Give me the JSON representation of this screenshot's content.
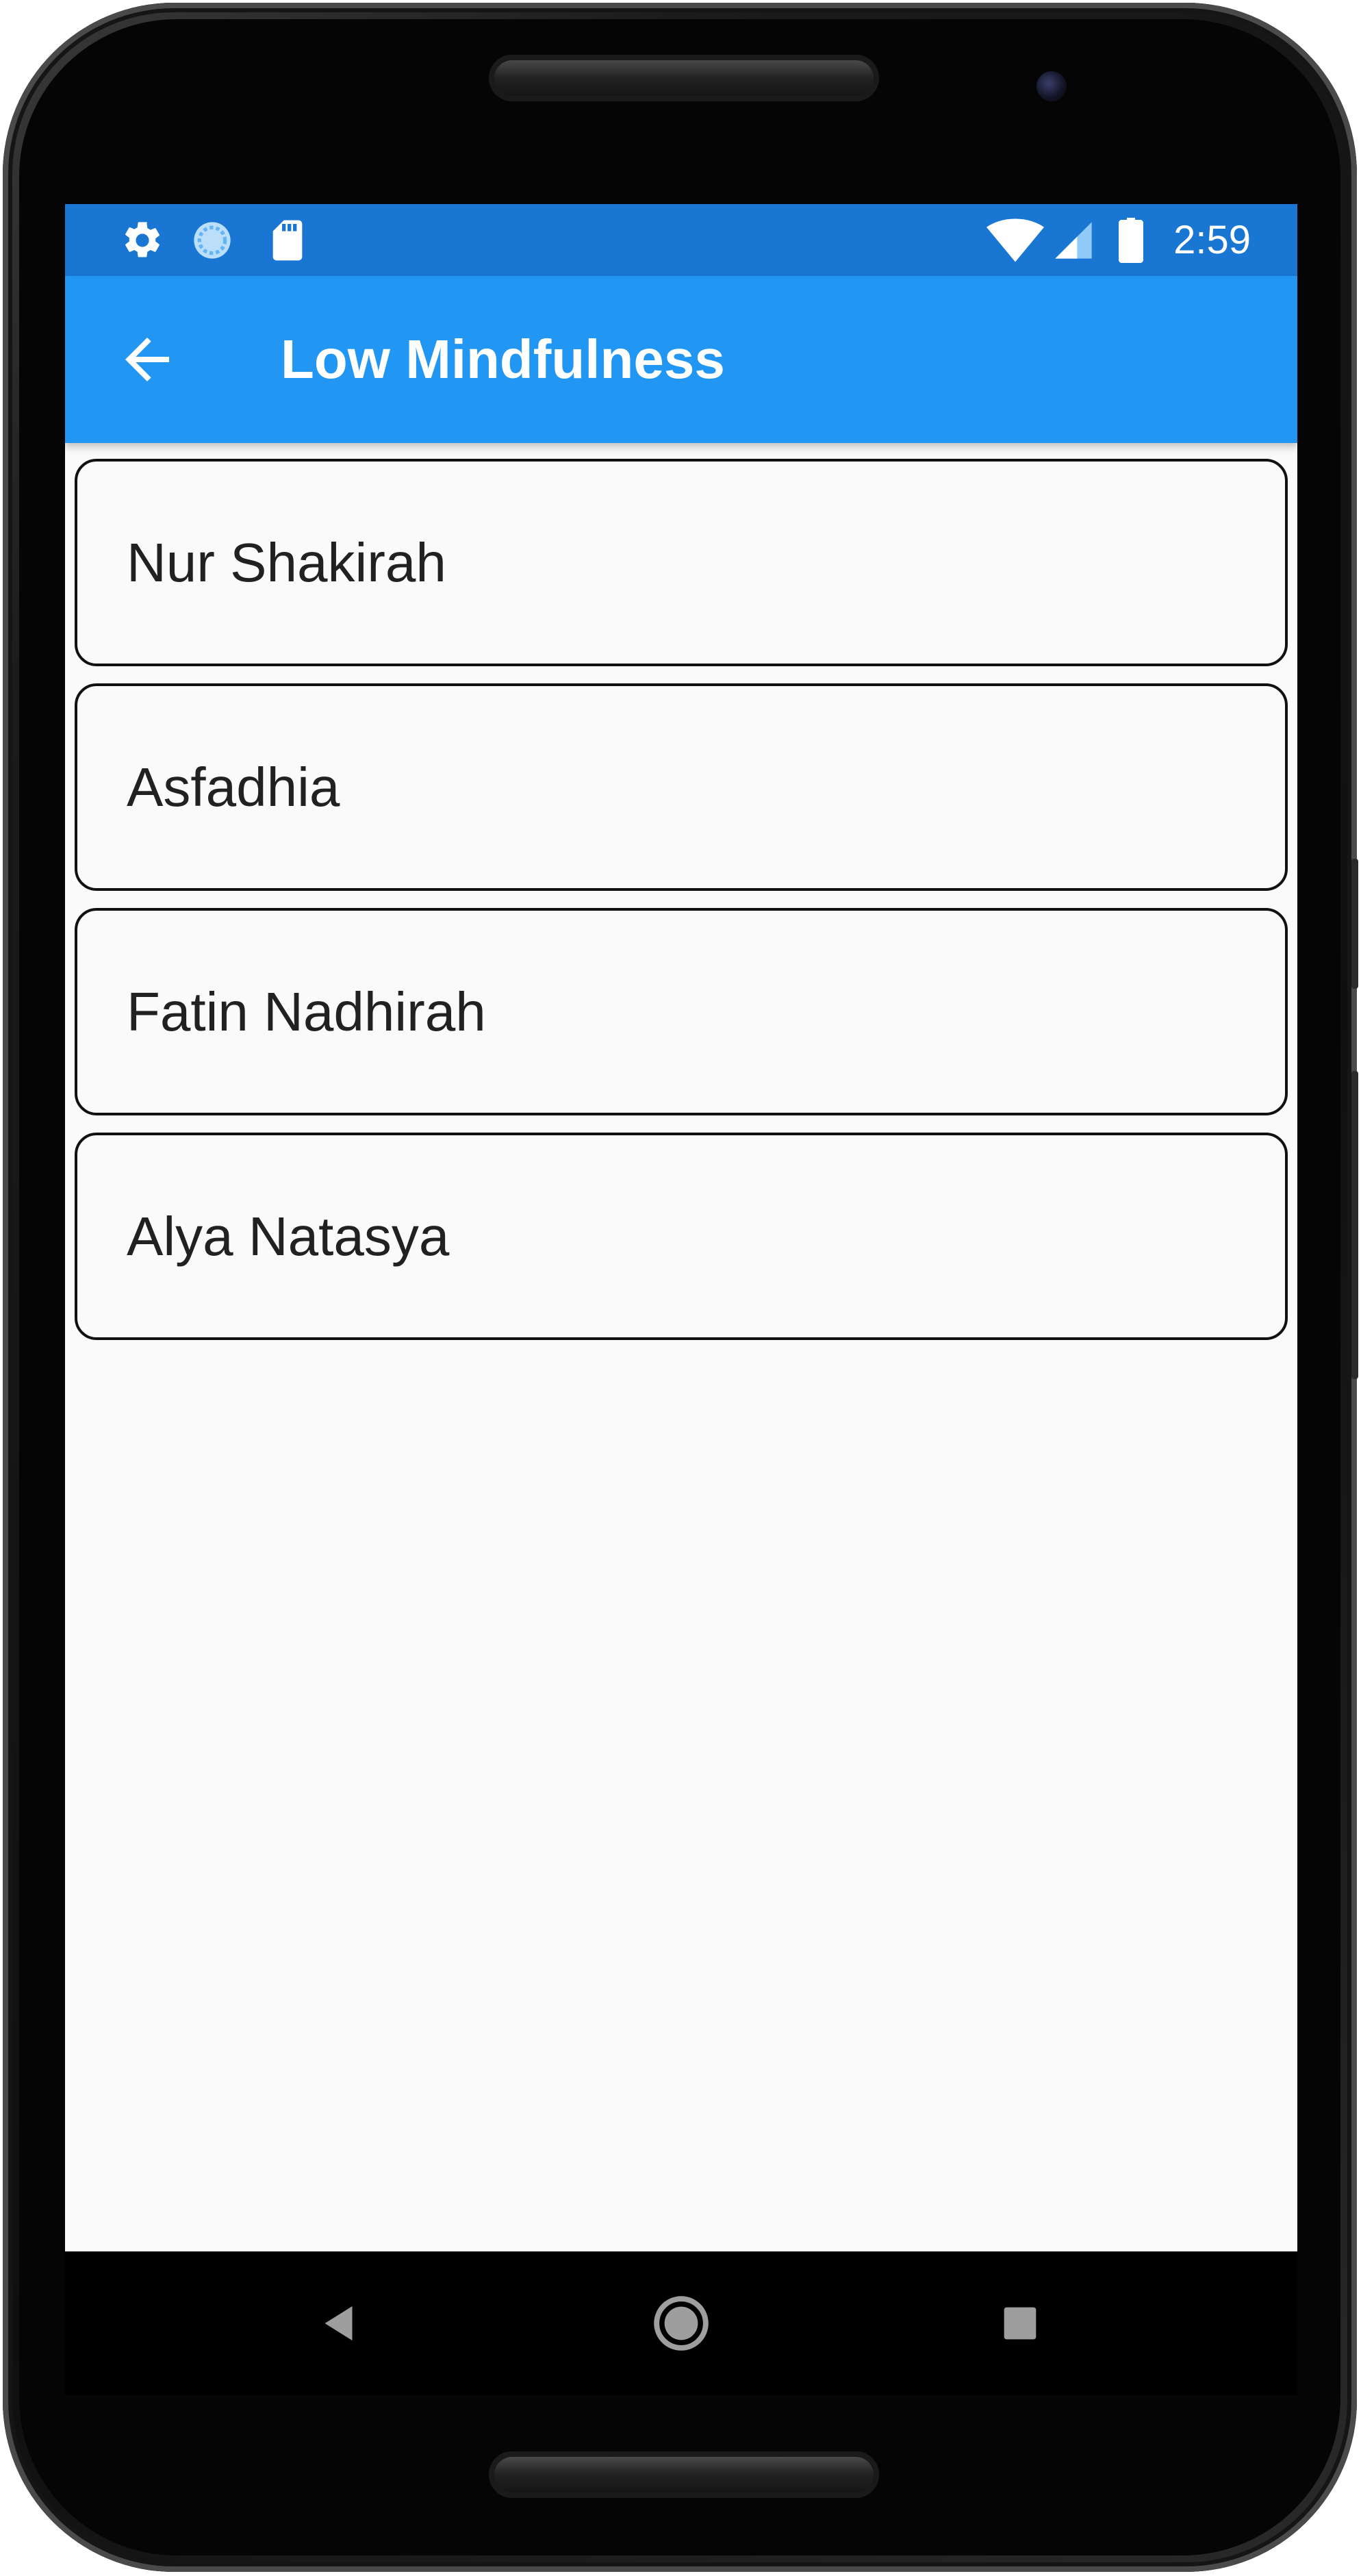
{
  "status_bar": {
    "time": "2:59",
    "left_icons": [
      "gear-icon",
      "sync-circle-icon",
      "sd-card-icon"
    ],
    "right_icons": [
      "wifi-icon",
      "cell-signal-icon",
      "battery-icon"
    ]
  },
  "app_bar": {
    "title": "Low Mindfulness",
    "back_icon": "arrow-back-icon",
    "color": "#2196f3",
    "status_color": "#1976d2"
  },
  "list": {
    "items": [
      {
        "label": "Nur Shakirah"
      },
      {
        "label": "Asfadhia"
      },
      {
        "label": "Fatin Nadhirah"
      },
      {
        "label": "Alya Natasya"
      }
    ]
  },
  "nav_bar": {
    "buttons": [
      "back-triangle-icon",
      "home-circle-icon",
      "recents-square-icon"
    ]
  }
}
